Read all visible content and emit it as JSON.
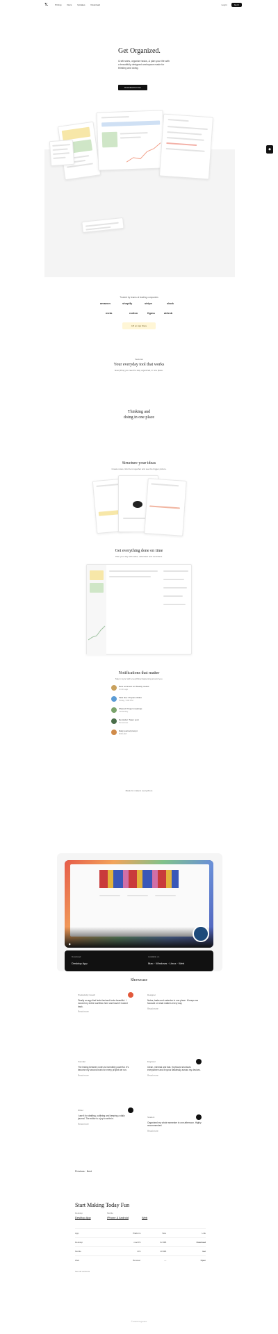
{
  "nav": {
    "logo": "Y.",
    "links": [
      "Pricing",
      "Docs",
      "Updates",
      "Download"
    ],
    "login": "Log in",
    "cta": "Get it"
  },
  "hero": {
    "title": "Get Organized.",
    "description": "Craft notes, organize tasks, & plan your life with a beautifully designed workspace made for thinking and doing.",
    "cta": "Download for free"
  },
  "trusted": {
    "label": "Trusted by teams at leading companies",
    "brands": [
      "amazon",
      "shopify",
      "stripe",
      "slack",
      "meta",
      "notion",
      "figma",
      "airbnb"
    ],
    "rating_text": "4.8 on App Store"
  },
  "section1": {
    "badge": "Features",
    "title": "Your everyday tool that works",
    "subtitle": "Everything you need to stay organized, in one place."
  },
  "section2": {
    "title_line1": "Thinking and",
    "title_line2": "doing in one place"
  },
  "section3": {
    "title": "Structure your ideas",
    "subtitle": "Create notes, link them together and see the bigger picture."
  },
  "section4": {
    "title": "Get everything done on time",
    "subtitle": "Plan your day with tasks, calendars and reminders."
  },
  "section5": {
    "title": "Notifications that matter",
    "subtitle": "Stay in sync with everything happening around you.",
    "items": [
      {
        "title": "New comment on Weekly review",
        "meta": "2 min ago"
      },
      {
        "title": "Task due: Prepare slides",
        "meta": "Today, 3:00 PM"
      },
      {
        "title": "Shared: Project roadmap",
        "meta": "Yesterday"
      },
      {
        "title": "Reminder: Team sync",
        "meta": "Tomorrow"
      },
      {
        "title": "Daily journal prompt",
        "meta": "8:00 AM"
      }
    ]
  },
  "section6": {
    "caption": "Made for makers everywhere"
  },
  "video": {
    "download_label": "Download",
    "download_value": "Desktop App",
    "platforms_label": "Available on",
    "platforms_value": "Mac · Windows · Linux · Web"
  },
  "showcase": {
    "title": "Showcase",
    "cards": [
      {
        "who": "Productivity Coach",
        "text": "Finally an app that feels fast and looks beautiful. I moved my entire workflow here and haven't looked back.",
        "more": "Read more"
      },
      {
        "who": "Designer",
        "text": "Notes, tasks and calendar in one place. It keeps me focused on what matters every day.",
        "more": "Read more"
      },
      {
        "who": "Founder",
        "text": "The linking between notes is incredibly powerful. It's become my second brain for every project we run.",
        "more": "Read more"
      },
      {
        "who": "Engineer",
        "text": "Clean, minimal and fast. Keyboard shortcuts everywhere and it syncs flawlessly across my devices.",
        "more": "Read more"
      },
      {
        "who": "Writer",
        "text": "I use it for drafting, outlining and keeping a daily journal. The editor is a joy to write in.",
        "more": "Read more"
      },
      {
        "who": "Student",
        "text": "Organized my whole semester in one afternoon. Highly recommended.",
        "more": "Read more"
      }
    ],
    "prev_next": "Previous · Next"
  },
  "start": {
    "title": "Start Making Today Fun",
    "tab1_label": "Desktop",
    "tab1_value": "Desktop App",
    "tab2_label": "Mobile",
    "tab2_value": "iPhone & Android",
    "tab3_value": "Web",
    "table_headers": [
      "App",
      "Platform",
      "Size",
      "Link"
    ],
    "rows": [
      [
        "Desktop",
        "macOS",
        "92 MB",
        "Download"
      ],
      [
        "Mobile",
        "iOS",
        "48 MB",
        "Get"
      ],
      [
        "Web",
        "Browser",
        "—",
        "Open"
      ]
    ],
    "footnote": "See all versions"
  },
  "footer": {
    "copyright": "© 2024 Organize"
  }
}
